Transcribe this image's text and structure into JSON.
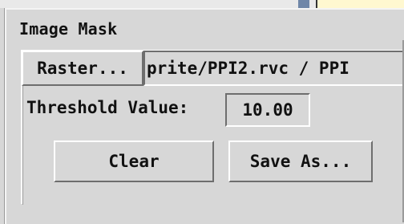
{
  "window": {
    "title": "Image Mask"
  },
  "raster": {
    "button_label": "Raster...",
    "path_value": "prite/PPI2.rvc / PPI"
  },
  "threshold": {
    "label": "Threshold Value:",
    "value": "10.00"
  },
  "actions": {
    "clear_label": "Clear",
    "save_as_label": "Save As..."
  }
}
